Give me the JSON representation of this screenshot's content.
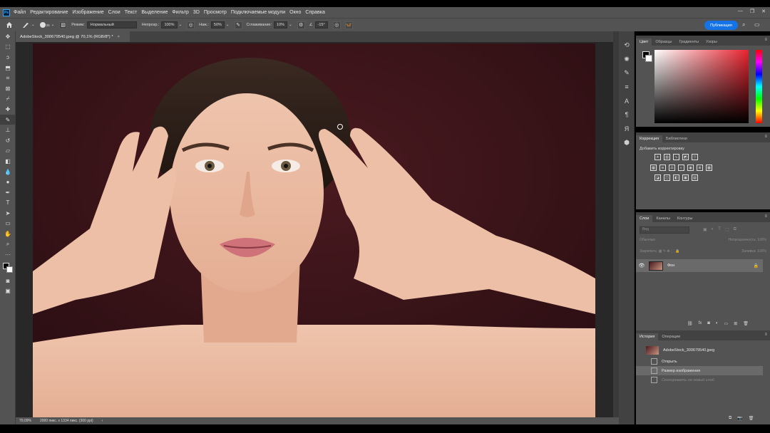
{
  "app": {
    "logo": "Ps"
  },
  "menu": [
    "Файл",
    "Редактирование",
    "Изображение",
    "Слои",
    "Текст",
    "Выделение",
    "Фильтр",
    "3D",
    "Просмотр",
    "Подключаемые модули",
    "Окно",
    "Справка"
  ],
  "window_controls": [
    "—",
    "❐",
    "✕"
  ],
  "options": {
    "brush_size": "25",
    "mode_label": "Режим:",
    "mode_value": "Нормальный",
    "opacity_label": "Непрозр.:",
    "opacity_value": "100%",
    "flow_label": "Наж.:",
    "flow_value": "50%",
    "smoothing_label": "Сглаживание:",
    "smoothing_value": "10%",
    "angle_value": "-15°",
    "publish_label": "Публикация"
  },
  "document": {
    "tab_title": "AdobeStock_300679540.jpeg @ 70,1% (RGB/8*) *",
    "tab_close": "×",
    "zoom": "70,09%",
    "dimensions": "2000 пикс. x 1334 пикс. (300 ppi)",
    "status_arrow": "›"
  },
  "panels": {
    "color_tabs": [
      "Цвет",
      "Образцы",
      "Градиенты",
      "Узоры"
    ],
    "adjustment_tabs": [
      "Коррекция",
      "Библиотеки"
    ],
    "adjustment_label": "Добавить корректировку",
    "layers_tabs": [
      "Слои",
      "Каналы",
      "Контуры"
    ],
    "layer_filter_placeholder": "Вид",
    "blend_mode": "Обычные",
    "opacity_label": "Непрозрачность:",
    "opacity_value": "100%",
    "lock_label": "Закрепить:",
    "fill_label": "Заливка:",
    "fill_value": "100%",
    "layer_name": "Фон",
    "history_tabs": [
      "История",
      "Операции"
    ],
    "history_snapshot": "AdobeStock_300679540.jpeg",
    "history_items": [
      "Открыть",
      "Размер изображения",
      "Скопировать на новый слой"
    ]
  },
  "colors": {
    "accent": "#1473e6",
    "foreground": "#000000",
    "background": "#ffffff"
  }
}
